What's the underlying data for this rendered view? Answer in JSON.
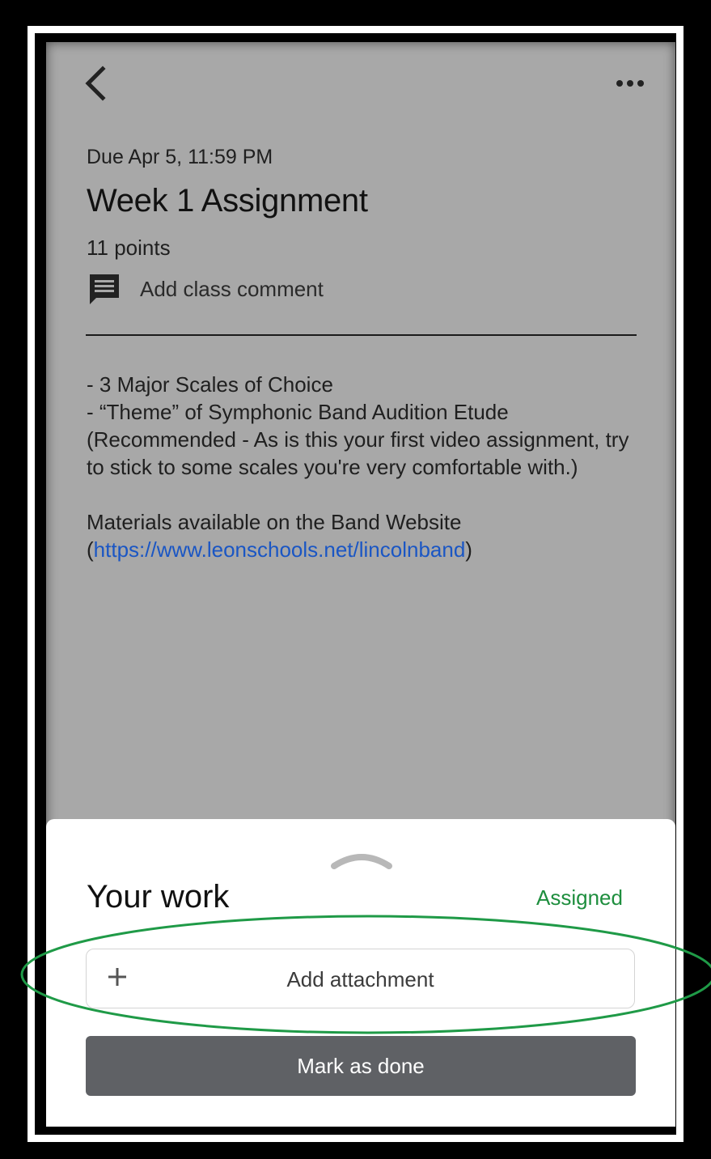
{
  "header": {
    "back_icon": "chevron-left-icon",
    "more_icon": "more-horizontal-icon"
  },
  "assignment": {
    "due": "Due Apr 5, 11:59 PM",
    "title": "Week 1 Assignment",
    "points": "11 points",
    "comment_label": "Add class comment",
    "comment_icon": "comment-icon",
    "description": {
      "line1": "- 3 Major Scales of Choice",
      "line2": "- “Theme” of Symphonic Band Audition Etude",
      "line3": "(Recommended - As is this your first video assignment, try to stick to some scales you're very comfortable with.)",
      "materials_prefix": "Materials available on the Band Website (",
      "materials_link": "https://www.leonschools.net/lincolnband",
      "materials_suffix": ")"
    }
  },
  "your_work": {
    "heading": "Your work",
    "status": "Assigned",
    "add_attachment_label": "Add attachment",
    "mark_done_label": "Mark as done"
  },
  "colors": {
    "status_green": "#1e8e3e",
    "link_blue": "#1a56c4",
    "button_gray": "#5f6165",
    "annotation_green": "#1f9a47"
  }
}
